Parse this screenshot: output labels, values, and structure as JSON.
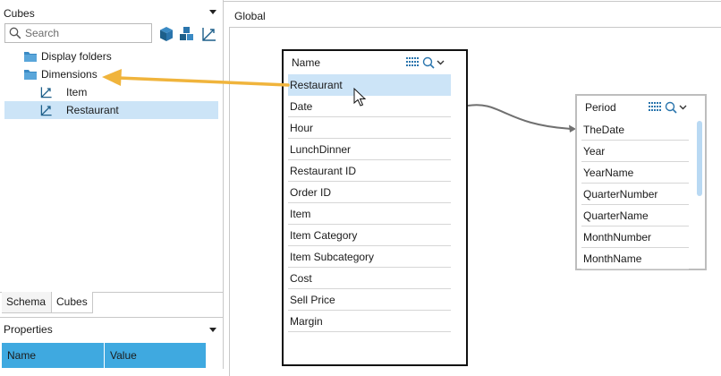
{
  "cubes_panel": {
    "title": "Cubes",
    "search": {
      "placeholder": "Search",
      "value": ""
    },
    "tree": [
      {
        "label": "Display folders",
        "icon": "folder-icon"
      },
      {
        "label": "Dimensions",
        "icon": "folder-icon"
      },
      {
        "label": "Item",
        "icon": "dimension-axis-icon"
      },
      {
        "label": "Restaurant",
        "icon": "dimension-axis-icon",
        "selected": true
      }
    ]
  },
  "tabs": [
    {
      "label": "Schema",
      "active": false
    },
    {
      "label": "Cubes",
      "active": true
    }
  ],
  "properties_panel": {
    "title": "Properties",
    "columns": [
      "Name",
      "Value"
    ]
  },
  "diagram": {
    "title": "Global",
    "tables": [
      {
        "title": "Name",
        "fields": [
          "Restaurant",
          "Date",
          "Hour",
          "LunchDinner",
          "Restaurant ID",
          "Order ID",
          "Item",
          "Item Category",
          "Item Subcategory",
          "Cost",
          "Sell Price",
          "Margin"
        ],
        "selected": "Restaurant"
      },
      {
        "title": "Period",
        "fields": [
          "TheDate",
          "Year",
          "YearName",
          "QuarterNumber",
          "QuarterName",
          "MonthNumber",
          "MonthName"
        ]
      }
    ]
  },
  "colors": {
    "selection": "#cce4f7",
    "header_blue": "#3fa9e0",
    "arrow": "#f0b43c",
    "connector": "#707070",
    "cube_icon": "#1d5f8a"
  }
}
